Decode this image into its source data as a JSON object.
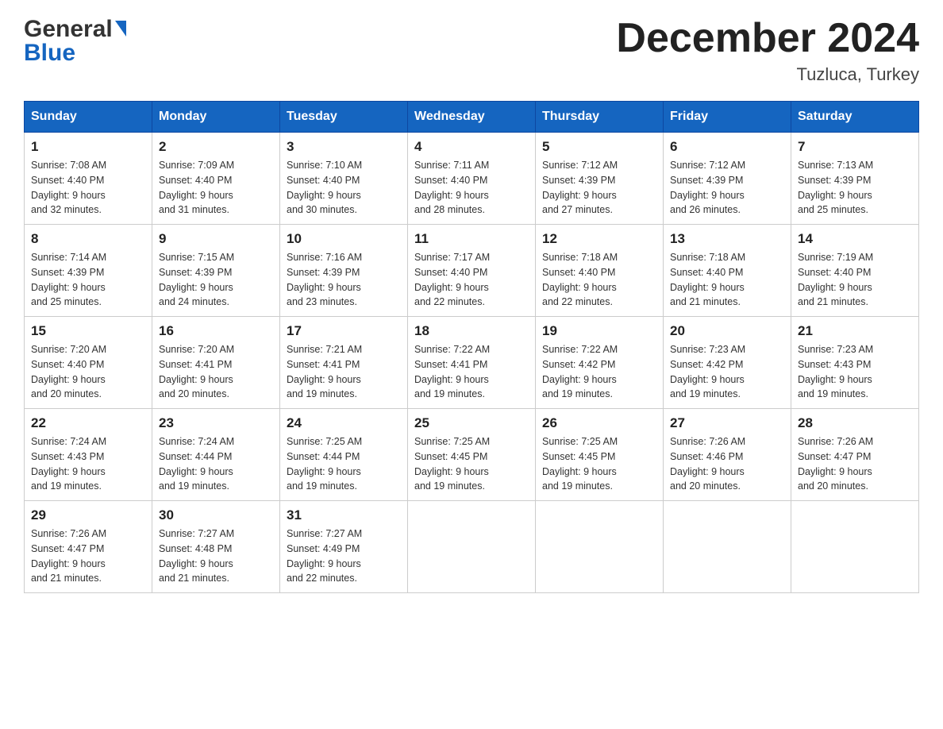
{
  "header": {
    "logo_line1": "General",
    "logo_line2": "Blue",
    "month_title": "December 2024",
    "location": "Tuzluca, Turkey"
  },
  "weekdays": [
    "Sunday",
    "Monday",
    "Tuesday",
    "Wednesday",
    "Thursday",
    "Friday",
    "Saturday"
  ],
  "weeks": [
    [
      {
        "day": "1",
        "sunrise": "7:08 AM",
        "sunset": "4:40 PM",
        "daylight": "9 hours and 32 minutes."
      },
      {
        "day": "2",
        "sunrise": "7:09 AM",
        "sunset": "4:40 PM",
        "daylight": "9 hours and 31 minutes."
      },
      {
        "day": "3",
        "sunrise": "7:10 AM",
        "sunset": "4:40 PM",
        "daylight": "9 hours and 30 minutes."
      },
      {
        "day": "4",
        "sunrise": "7:11 AM",
        "sunset": "4:40 PM",
        "daylight": "9 hours and 28 minutes."
      },
      {
        "day": "5",
        "sunrise": "7:12 AM",
        "sunset": "4:39 PM",
        "daylight": "9 hours and 27 minutes."
      },
      {
        "day": "6",
        "sunrise": "7:12 AM",
        "sunset": "4:39 PM",
        "daylight": "9 hours and 26 minutes."
      },
      {
        "day": "7",
        "sunrise": "7:13 AM",
        "sunset": "4:39 PM",
        "daylight": "9 hours and 25 minutes."
      }
    ],
    [
      {
        "day": "8",
        "sunrise": "7:14 AM",
        "sunset": "4:39 PM",
        "daylight": "9 hours and 25 minutes."
      },
      {
        "day": "9",
        "sunrise": "7:15 AM",
        "sunset": "4:39 PM",
        "daylight": "9 hours and 24 minutes."
      },
      {
        "day": "10",
        "sunrise": "7:16 AM",
        "sunset": "4:39 PM",
        "daylight": "9 hours and 23 minutes."
      },
      {
        "day": "11",
        "sunrise": "7:17 AM",
        "sunset": "4:40 PM",
        "daylight": "9 hours and 22 minutes."
      },
      {
        "day": "12",
        "sunrise": "7:18 AM",
        "sunset": "4:40 PM",
        "daylight": "9 hours and 22 minutes."
      },
      {
        "day": "13",
        "sunrise": "7:18 AM",
        "sunset": "4:40 PM",
        "daylight": "9 hours and 21 minutes."
      },
      {
        "day": "14",
        "sunrise": "7:19 AM",
        "sunset": "4:40 PM",
        "daylight": "9 hours and 21 minutes."
      }
    ],
    [
      {
        "day": "15",
        "sunrise": "7:20 AM",
        "sunset": "4:40 PM",
        "daylight": "9 hours and 20 minutes."
      },
      {
        "day": "16",
        "sunrise": "7:20 AM",
        "sunset": "4:41 PM",
        "daylight": "9 hours and 20 minutes."
      },
      {
        "day": "17",
        "sunrise": "7:21 AM",
        "sunset": "4:41 PM",
        "daylight": "9 hours and 19 minutes."
      },
      {
        "day": "18",
        "sunrise": "7:22 AM",
        "sunset": "4:41 PM",
        "daylight": "9 hours and 19 minutes."
      },
      {
        "day": "19",
        "sunrise": "7:22 AM",
        "sunset": "4:42 PM",
        "daylight": "9 hours and 19 minutes."
      },
      {
        "day": "20",
        "sunrise": "7:23 AM",
        "sunset": "4:42 PM",
        "daylight": "9 hours and 19 minutes."
      },
      {
        "day": "21",
        "sunrise": "7:23 AM",
        "sunset": "4:43 PM",
        "daylight": "9 hours and 19 minutes."
      }
    ],
    [
      {
        "day": "22",
        "sunrise": "7:24 AM",
        "sunset": "4:43 PM",
        "daylight": "9 hours and 19 minutes."
      },
      {
        "day": "23",
        "sunrise": "7:24 AM",
        "sunset": "4:44 PM",
        "daylight": "9 hours and 19 minutes."
      },
      {
        "day": "24",
        "sunrise": "7:25 AM",
        "sunset": "4:44 PM",
        "daylight": "9 hours and 19 minutes."
      },
      {
        "day": "25",
        "sunrise": "7:25 AM",
        "sunset": "4:45 PM",
        "daylight": "9 hours and 19 minutes."
      },
      {
        "day": "26",
        "sunrise": "7:25 AM",
        "sunset": "4:45 PM",
        "daylight": "9 hours and 19 minutes."
      },
      {
        "day": "27",
        "sunrise": "7:26 AM",
        "sunset": "4:46 PM",
        "daylight": "9 hours and 20 minutes."
      },
      {
        "day": "28",
        "sunrise": "7:26 AM",
        "sunset": "4:47 PM",
        "daylight": "9 hours and 20 minutes."
      }
    ],
    [
      {
        "day": "29",
        "sunrise": "7:26 AM",
        "sunset": "4:47 PM",
        "daylight": "9 hours and 21 minutes."
      },
      {
        "day": "30",
        "sunrise": "7:27 AM",
        "sunset": "4:48 PM",
        "daylight": "9 hours and 21 minutes."
      },
      {
        "day": "31",
        "sunrise": "7:27 AM",
        "sunset": "4:49 PM",
        "daylight": "9 hours and 22 minutes."
      },
      null,
      null,
      null,
      null
    ]
  ],
  "labels": {
    "sunrise": "Sunrise:",
    "sunset": "Sunset:",
    "daylight": "Daylight:"
  }
}
